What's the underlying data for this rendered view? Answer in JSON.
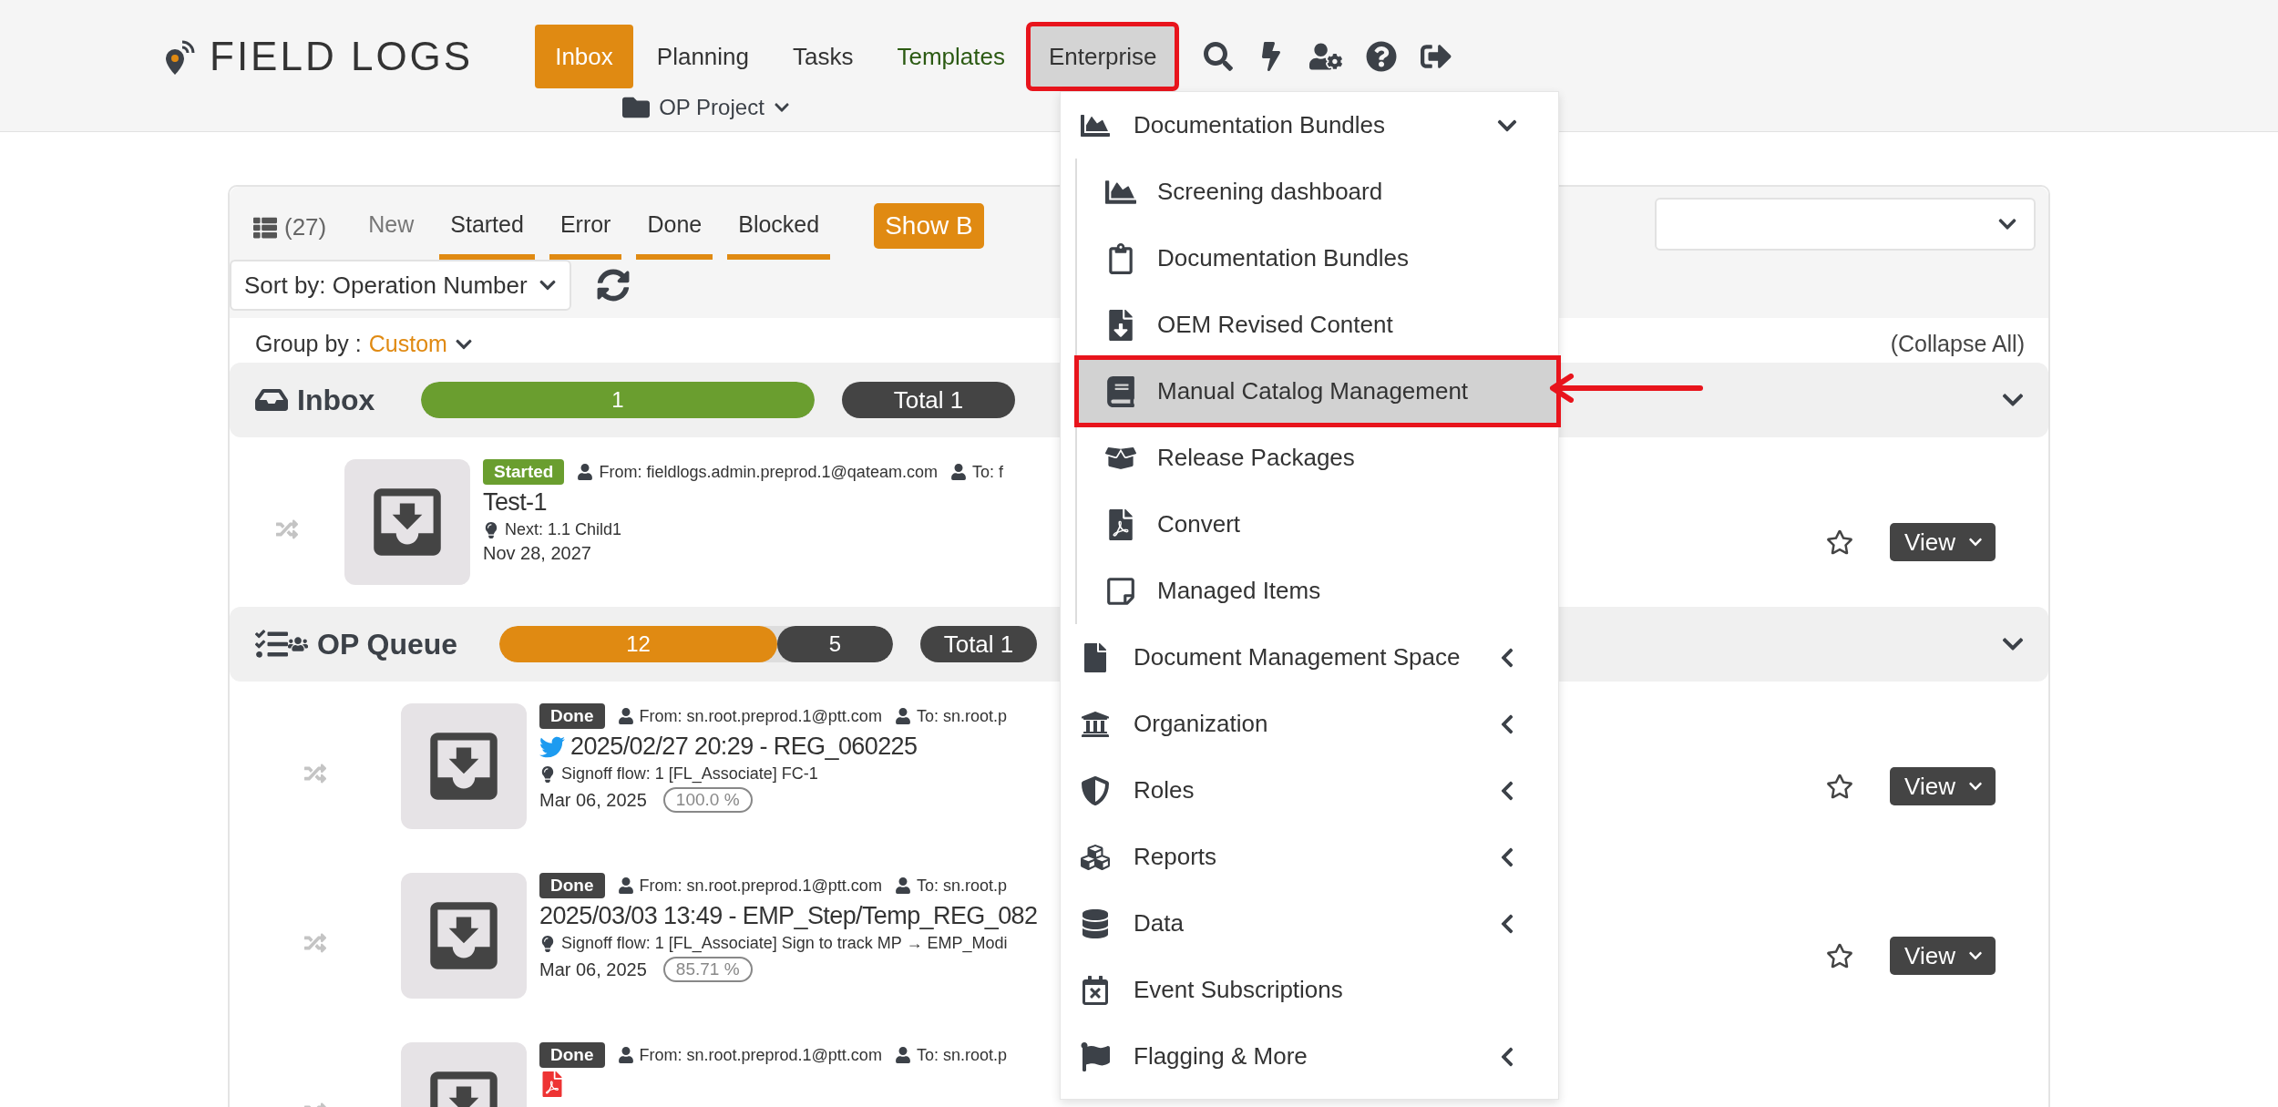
{
  "header": {
    "logo": "FIELD LOGS",
    "nav": [
      {
        "label": "Inbox",
        "selected": true,
        "open": false,
        "annotated": false
      },
      {
        "label": "Planning",
        "selected": false,
        "open": false,
        "annotated": false
      },
      {
        "label": "Tasks",
        "selected": false,
        "open": false,
        "annotated": false
      },
      {
        "label": "Templates",
        "selected": false,
        "open": false,
        "annotated": false,
        "color": "#2b5a12"
      },
      {
        "label": "Enterprise",
        "selected": false,
        "open": true,
        "annotated": true
      }
    ],
    "project": "OP Project"
  },
  "toolbar": {
    "count": "(27)",
    "filters": [
      {
        "label": "New",
        "selected": false
      },
      {
        "label": "Started",
        "selected": true
      },
      {
        "label": "Error",
        "selected": true
      },
      {
        "label": "Done",
        "selected": true
      },
      {
        "label": "Blocked",
        "selected": true
      }
    ],
    "show_button": "Show B",
    "sort": "Sort by: Operation Number",
    "group_by_label": "Group by :",
    "group_by_value": "Custom",
    "collapse": "(Collapse All)"
  },
  "groups": [
    {
      "title": "Inbox",
      "segments": [
        {
          "value": "1",
          "level": 1,
          "color": "#6a9e2f"
        }
      ],
      "total": "Total 1",
      "rows": [
        {
          "status": "Started",
          "kind": "started",
          "from": "From: fieldlogs.admin.preprod.1@qateam.com",
          "to": "To: f",
          "title": "Test-1",
          "detail": "Next: 1.1 Child1",
          "date": "Nov 28, 2027",
          "starred": false,
          "action": "View"
        }
      ]
    },
    {
      "title": "OP Queue",
      "segments": [
        {
          "value": "12",
          "level": 0.706,
          "color": "#e08a12"
        },
        {
          "value": "5",
          "level": 0.294,
          "color": "#444444"
        }
      ],
      "total": "Total 1",
      "rows": [
        {
          "status": "Done",
          "kind": "done",
          "from": "From: sn.root.preprod.1@ptt.com",
          "to": "To: sn.root.p",
          "title": "2025/02/27 20:29 - REG_060225",
          "detail": "Signoff flow: 1 [FL_Associate] FC-1",
          "date": "Mar 06, 2025",
          "percent": "100.0 %",
          "starred": false,
          "action": "View"
        },
        {
          "status": "Done",
          "kind": "done",
          "from": "From: sn.root.preprod.1@ptt.com",
          "to": "To: sn.root.p",
          "title": "2025/03/03 13:49 - EMP_Step/Temp_REG_082",
          "detail": "Signoff flow: 1 [FL_Associate] Sign to track MP → EMP_Modi",
          "date": "Mar 06, 2025",
          "percent": "85.71 %",
          "starred": false,
          "action": "View"
        },
        {
          "status": "Done",
          "kind": "done",
          "from": "From: sn.root.preprod.1@ptt.com",
          "to": "To: sn.root.p"
        }
      ]
    }
  ],
  "menu": {
    "items": [
      {
        "label": "Documentation Bundles",
        "kind": "group",
        "expanded": true,
        "children": [
          {
            "label": "Screening dashboard",
            "selected": false,
            "annotated": false
          },
          {
            "label": "Documentation Bundles",
            "selected": false,
            "annotated": false
          },
          {
            "label": "OEM Revised Content",
            "selected": false,
            "annotated": false
          },
          {
            "label": "Manual Catalog Management",
            "selected": true,
            "annotated": true
          },
          {
            "label": "Release Packages",
            "selected": false,
            "annotated": false
          },
          {
            "label": "Convert",
            "selected": false,
            "annotated": false
          },
          {
            "label": "Managed Items",
            "selected": false,
            "annotated": false
          }
        ]
      },
      {
        "label": "Document Management Space",
        "kind": "group",
        "expanded": false
      },
      {
        "label": "Organization",
        "kind": "group",
        "expanded": false
      },
      {
        "label": "Roles",
        "kind": "group",
        "expanded": false
      },
      {
        "label": "Reports",
        "kind": "group",
        "expanded": false
      },
      {
        "label": "Data",
        "kind": "group",
        "expanded": false
      },
      {
        "label": "Event Subscriptions",
        "kind": "link"
      },
      {
        "label": "Flagging & More",
        "kind": "group",
        "expanded": false
      }
    ]
  }
}
